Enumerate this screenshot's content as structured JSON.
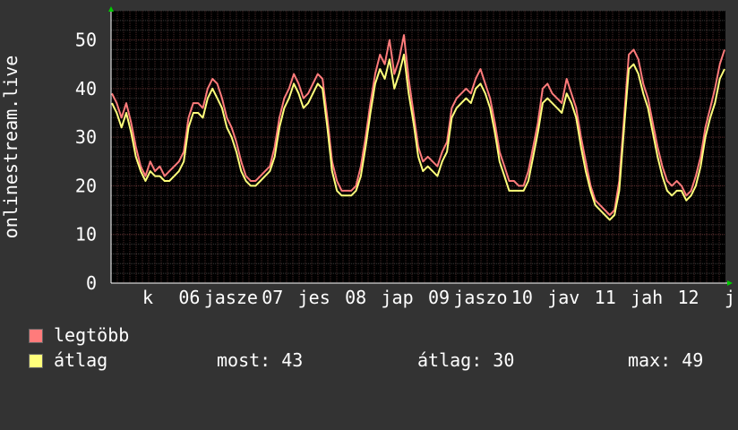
{
  "chart_data": {
    "type": "line",
    "ylabel": "onlinestream.live",
    "xlabel": "",
    "ylim": [
      0,
      56
    ],
    "y_ticks": [
      0,
      10,
      20,
      30,
      40,
      50
    ],
    "x_tick_labels": [
      "k",
      "06",
      "jasze",
      "07",
      "jes",
      "08",
      "jap",
      "09",
      "jaszo",
      "10",
      "jav",
      "11",
      "jah",
      "12",
      "j"
    ],
    "grid": true,
    "legend_placement": "bottom-left",
    "series": [
      {
        "name": "legtöbb",
        "color": "#ff7b7b",
        "values": [
          39,
          37,
          34,
          37,
          33,
          28,
          24,
          22,
          25,
          23,
          24,
          22,
          23,
          24,
          25,
          27,
          34,
          37,
          37,
          36,
          40,
          42,
          41,
          38,
          34,
          32,
          29,
          25,
          22,
          21,
          21,
          22,
          23,
          24,
          28,
          34,
          38,
          40,
          43,
          41,
          38,
          39,
          41,
          43,
          42,
          34,
          25,
          21,
          19,
          19,
          19,
          20,
          24,
          30,
          37,
          43,
          47,
          45,
          50,
          43,
          46,
          51,
          42,
          35,
          28,
          25,
          26,
          25,
          24,
          27,
          29,
          36,
          38,
          39,
          40,
          39,
          42,
          44,
          41,
          38,
          33,
          27,
          24,
          21,
          21,
          20,
          20,
          23,
          28,
          33,
          40,
          41,
          39,
          38,
          37,
          42,
          39,
          36,
          30,
          25,
          20,
          17,
          16,
          15,
          14,
          15,
          21,
          34,
          47,
          48,
          46,
          41,
          38,
          33,
          28,
          24,
          21,
          20,
          21,
          20,
          18,
          19,
          22,
          26,
          32,
          36,
          40,
          45,
          48
        ]
      },
      {
        "name": "átlag",
        "color": "#ffff7b",
        "values": [
          37,
          35,
          32,
          35,
          31,
          26,
          23,
          21,
          23,
          22,
          22,
          21,
          21,
          22,
          23,
          25,
          32,
          35,
          35,
          34,
          38,
          40,
          38,
          36,
          32,
          30,
          27,
          23,
          21,
          20,
          20,
          21,
          22,
          23,
          26,
          32,
          36,
          38,
          41,
          39,
          36,
          37,
          39,
          41,
          40,
          32,
          23,
          19,
          18,
          18,
          18,
          19,
          22,
          28,
          35,
          41,
          44,
          42,
          46,
          40,
          43,
          47,
          39,
          33,
          26,
          23,
          24,
          23,
          22,
          25,
          27,
          34,
          36,
          37,
          38,
          37,
          40,
          41,
          39,
          36,
          31,
          25,
          22,
          19,
          19,
          19,
          19,
          21,
          26,
          31,
          37,
          38,
          37,
          36,
          35,
          39,
          37,
          34,
          28,
          23,
          19,
          16,
          15,
          14,
          13,
          14,
          19,
          32,
          44,
          45,
          43,
          39,
          36,
          31,
          26,
          22,
          19,
          18,
          19,
          19,
          17,
          18,
          20,
          24,
          30,
          34,
          37,
          42,
          44
        ]
      }
    ]
  },
  "legend": [
    {
      "label": "legtöbb",
      "color": "#ff7b7b"
    },
    {
      "label": "átlag",
      "color": "#ffff7b"
    }
  ],
  "stats": {
    "most": "most: 43",
    "atlag": "átlag: 30",
    "max": "max: 49"
  }
}
